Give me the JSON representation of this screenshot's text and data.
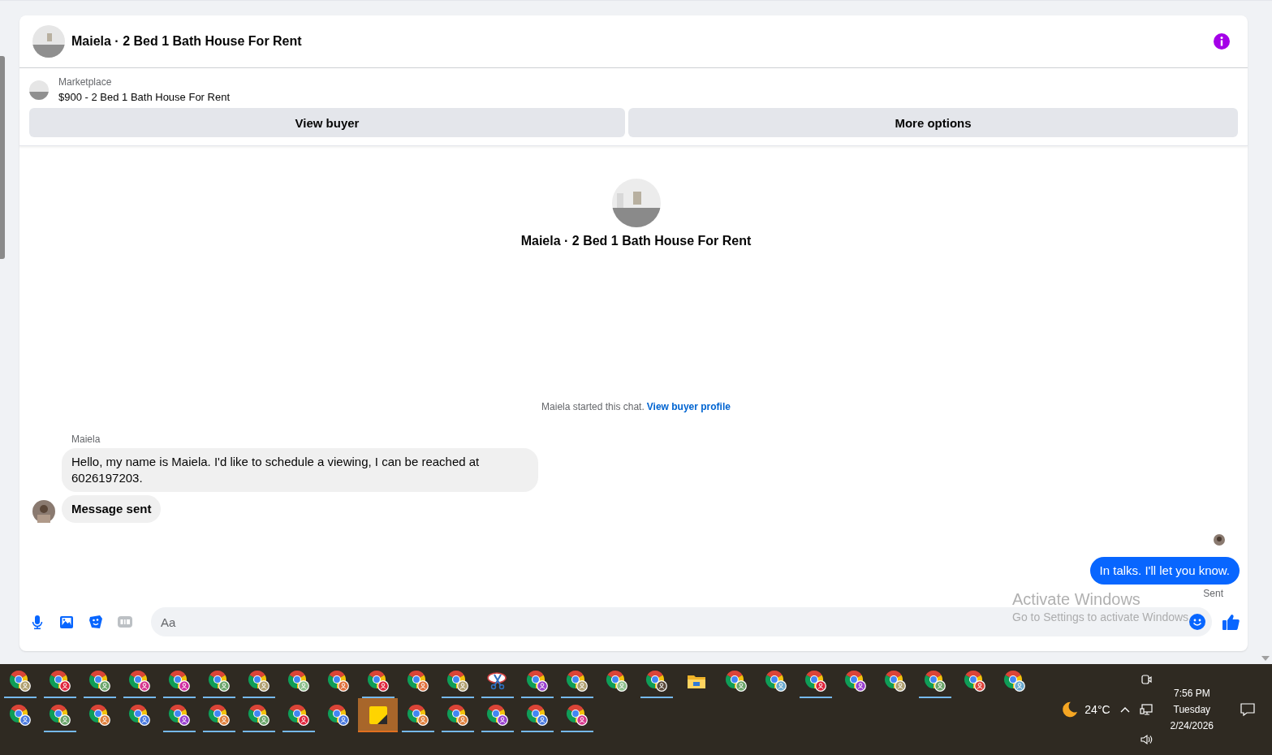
{
  "conversation": {
    "title": "Maiela · 2 Bed 1 Bath House For Rent"
  },
  "listing": {
    "source": "Marketplace",
    "summary": "$900 - 2 Bed 1 Bath House For Rent"
  },
  "actions": [
    "View buyer",
    "More options"
  ],
  "chat_intro": {
    "title": "Maiela · 2 Bed 1 Bath House For Rent",
    "started_text": "Maiela started this chat.",
    "link": "View buyer profile"
  },
  "messages": [
    {
      "kind": "incoming",
      "sender": "Maiela",
      "text": "Hello, my name is Maiela. I'd like to schedule a viewing, I can be reached at 6026197203."
    },
    {
      "kind": "notice",
      "text": "Message sent"
    },
    {
      "kind": "outgoing",
      "text": "In talks. I'll let you know.",
      "status": "Sent"
    }
  ],
  "composer": {
    "placeholder": "Aa"
  },
  "os_watermark": {
    "title": "Activate Windows",
    "subtitle": "Go to Settings to activate Windows."
  },
  "taskbar": {
    "rows": [
      [
        {
          "kind": "chrome",
          "color": "#b0a070",
          "running": true,
          "selected": false
        },
        {
          "kind": "chrome",
          "color": "#e0243c",
          "running": true,
          "selected": false
        },
        {
          "kind": "chrome",
          "color": "#6aa56a",
          "running": true,
          "selected": false
        },
        {
          "kind": "chrome",
          "color": "#d6358c",
          "running": true,
          "selected": false
        },
        {
          "kind": "chrome",
          "color": "#d02ca0",
          "running": true,
          "selected": false
        },
        {
          "kind": "chrome",
          "color": "#6aa56a",
          "running": true,
          "selected": false
        },
        {
          "kind": "chrome",
          "color": "#b0a070",
          "running": true,
          "selected": false
        },
        {
          "kind": "chrome",
          "color": "#8cc08c",
          "running": false,
          "selected": false
        },
        {
          "kind": "chrome",
          "color": "#e0703c",
          "running": false,
          "selected": false
        },
        {
          "kind": "chrome",
          "color": "#e0243c",
          "running": true,
          "selected": false
        },
        {
          "kind": "chrome",
          "color": "#e0703c",
          "running": false,
          "selected": false
        },
        {
          "kind": "chrome",
          "color": "#b0a070",
          "running": true,
          "selected": false
        },
        {
          "kind": "snip",
          "running": true,
          "selected": false
        },
        {
          "kind": "chrome",
          "color": "#9a40d0",
          "running": true,
          "selected": false
        },
        {
          "kind": "chrome",
          "color": "#b0a070",
          "running": true,
          "selected": false
        },
        {
          "kind": "chrome",
          "color": "#8cc08c",
          "running": false,
          "selected": false
        },
        {
          "kind": "chrome",
          "color": "#5a4a3c",
          "running": true,
          "selected": false
        },
        {
          "kind": "folder",
          "running": false,
          "selected": false
        },
        {
          "kind": "chrome",
          "color": "#6aa56a",
          "running": false,
          "selected": false
        },
        {
          "kind": "chrome",
          "color": "#6aaad0",
          "running": false,
          "selected": false
        },
        {
          "kind": "chrome",
          "color": "#e0243c",
          "running": true,
          "selected": false
        },
        {
          "kind": "chrome",
          "color": "#9a40d0",
          "running": false,
          "selected": false
        },
        {
          "kind": "chrome",
          "color": "#b0a070",
          "running": false,
          "selected": false
        },
        {
          "kind": "chrome",
          "color": "#6aa56a",
          "running": true,
          "selected": false
        },
        {
          "kind": "chrome",
          "color": "#e0433c",
          "running": false,
          "selected": false
        },
        {
          "kind": "chrome",
          "color": "#6aaad0",
          "running": false,
          "selected": false
        }
      ],
      [
        {
          "kind": "chrome",
          "color": "#4a7ae0",
          "running": false,
          "selected": false
        },
        {
          "kind": "chrome",
          "color": "#6aa56a",
          "running": true,
          "selected": false
        },
        {
          "kind": "chrome",
          "color": "#e0803c",
          "running": false,
          "selected": false
        },
        {
          "kind": "chrome",
          "color": "#4a7ae0",
          "running": false,
          "selected": false
        },
        {
          "kind": "chrome",
          "color": "#9a40d0",
          "running": true,
          "selected": false
        },
        {
          "kind": "chrome",
          "color": "#e0803c",
          "running": true,
          "selected": false
        },
        {
          "kind": "chrome",
          "color": "#6aa56a",
          "running": true,
          "selected": false
        },
        {
          "kind": "chrome",
          "color": "#e0243c",
          "running": true,
          "selected": false
        },
        {
          "kind": "chrome",
          "color": "#4a7ae0",
          "running": false,
          "selected": false
        },
        {
          "kind": "sticky",
          "running": true,
          "selected": true
        },
        {
          "kind": "chrome",
          "color": "#e0803c",
          "running": true,
          "selected": false
        },
        {
          "kind": "chrome",
          "color": "#e0803c",
          "running": true,
          "selected": false
        },
        {
          "kind": "chrome",
          "color": "#9a40d0",
          "running": true,
          "selected": false
        },
        {
          "kind": "chrome",
          "color": "#4a7ae0",
          "running": true,
          "selected": false
        },
        {
          "kind": "chrome",
          "color": "#d6358c",
          "running": true,
          "selected": false
        }
      ]
    ],
    "tray": {
      "temperature": "24°C",
      "time": "7:56 PM",
      "day": "Tuesday",
      "date": "2/24/2026"
    }
  }
}
